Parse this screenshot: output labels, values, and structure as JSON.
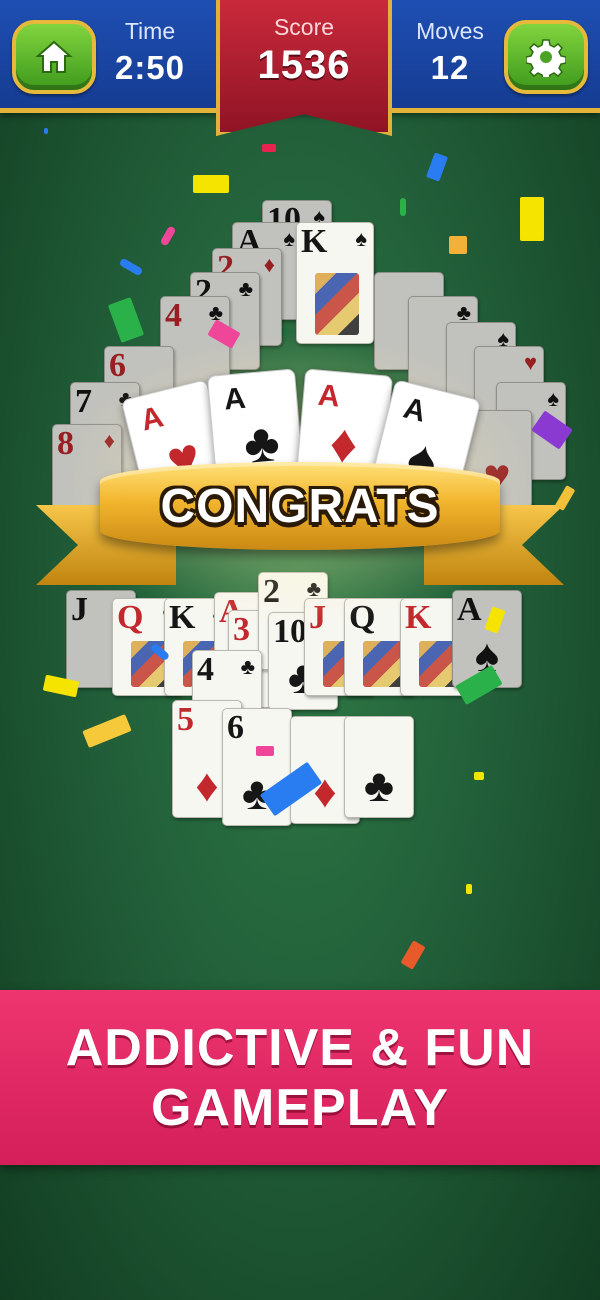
{
  "hud": {
    "time_label": "Time",
    "time_value": "2:50",
    "score_label": "Score",
    "score_value": "1536",
    "moves_label": "Moves",
    "moves_value": "12",
    "home_icon": "home-icon",
    "settings_icon": "gear-icon"
  },
  "aces": [
    {
      "rank": "A",
      "suit": "♥",
      "color": "red"
    },
    {
      "rank": "A",
      "suit": "♣",
      "color": "black"
    },
    {
      "rank": "A",
      "suit": "♦",
      "color": "red"
    },
    {
      "rank": "A",
      "suit": "♠",
      "color": "black"
    }
  ],
  "banner": {
    "text": "CONGRATS"
  },
  "cards": [
    {
      "rank": "10",
      "suit": "♠"
    },
    {
      "rank": "A",
      "suit": "♠"
    },
    {
      "rank": "K",
      "suit": "♠"
    },
    {
      "rank": "2",
      "suit": "♦"
    },
    {
      "rank": "2",
      "suit": "♣"
    },
    {
      "rank": "4",
      "suit": "♣"
    },
    {
      "rank": "6",
      "suit": "♦"
    },
    {
      "rank": "7",
      "suit": "♣"
    },
    {
      "rank": "8",
      "suit": "♦"
    },
    {
      "rank": "J",
      "suit": "♠"
    },
    {
      "rank": "Q",
      "suit": "♥"
    },
    {
      "rank": "K",
      "suit": "♣"
    },
    {
      "rank": "A",
      "suit": "♦"
    },
    {
      "rank": "3",
      "suit": "♦"
    },
    {
      "rank": "2",
      "suit": "♣"
    },
    {
      "rank": "10",
      "suit": "♣"
    },
    {
      "rank": "J",
      "suit": "♦"
    },
    {
      "rank": "Q",
      "suit": "♣"
    },
    {
      "rank": "K",
      "suit": "♥"
    },
    {
      "rank": "A",
      "suit": "♠"
    },
    {
      "rank": "4",
      "suit": "♣"
    },
    {
      "rank": "5",
      "suit": "♦"
    },
    {
      "rank": "6",
      "suit": "♣"
    }
  ],
  "promo": {
    "line1": "ADDICTIVE & FUN",
    "line2": "GAMEPLAY"
  },
  "colors": {
    "felt": "#22603a",
    "topbar": "#1f4fb3",
    "score_ribbon": "#c92a3b",
    "button_green": "#5cb82c",
    "gold": "#e4b43a",
    "promo_pink": "#e42a64"
  }
}
